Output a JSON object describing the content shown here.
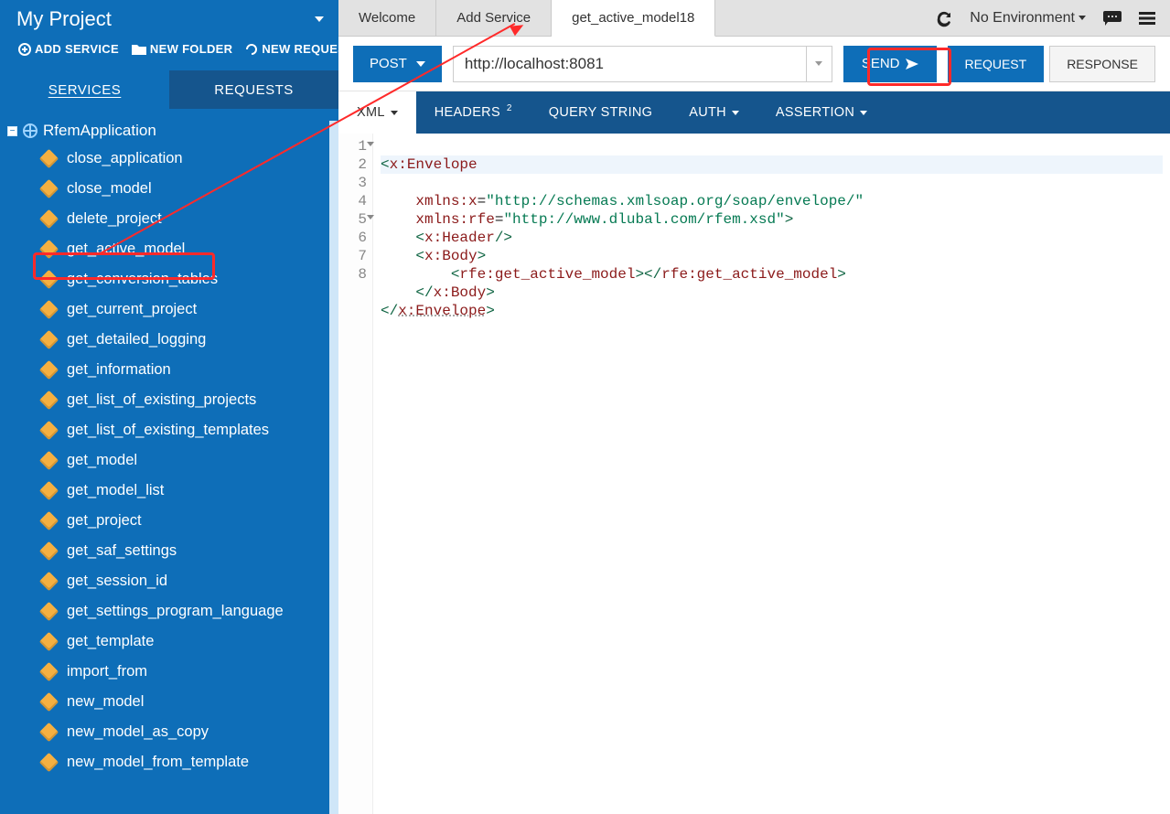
{
  "sidebar": {
    "project_title": "My Project",
    "actions": {
      "add_service": "ADD SERVICE",
      "new_folder": "NEW FOLDER",
      "new_request": "NEW REQUEST"
    },
    "tabs": {
      "services": "SERVICES",
      "requests": "REQUESTS"
    },
    "tree": {
      "root": "RfemApplication",
      "items": [
        "close_application",
        "close_model",
        "delete_project",
        "get_active_model",
        "get_conversion_tables",
        "get_current_project",
        "get_detailed_logging",
        "get_information",
        "get_list_of_existing_projects",
        "get_list_of_existing_templates",
        "get_model",
        "get_model_list",
        "get_project",
        "get_saf_settings",
        "get_session_id",
        "get_settings_program_language",
        "get_template",
        "import_from",
        "new_model",
        "new_model_as_copy",
        "new_model_from_template"
      ]
    }
  },
  "topbar": {
    "tabs": [
      {
        "label": "Welcome",
        "active": false
      },
      {
        "label": "Add Service",
        "active": false
      },
      {
        "label": "get_active_model18",
        "active": true
      }
    ],
    "environment": "No Environment"
  },
  "request": {
    "method": "POST",
    "url": "http://localhost:8081",
    "send": "SEND",
    "rr": {
      "request": "REQUEST",
      "response": "RESPONSE"
    },
    "sub_tabs": {
      "xml": "XML",
      "headers": "HEADERS",
      "headers_badge": "2",
      "query_string": "QUERY STRING",
      "auth": "AUTH",
      "assertion": "ASSERTION"
    }
  },
  "editor": {
    "lines": [
      "<x:Envelope",
      "    xmlns:x=\"http://schemas.xmlsoap.org/soap/envelope/\"",
      "    xmlns:rfe=\"http://www.dlubal.com/rfem.xsd\">",
      "    <x:Header/>",
      "    <x:Body>",
      "        <rfe:get_active_model></rfe:get_active_model>",
      "    </x:Body>",
      "</x:Envelope>"
    ]
  }
}
